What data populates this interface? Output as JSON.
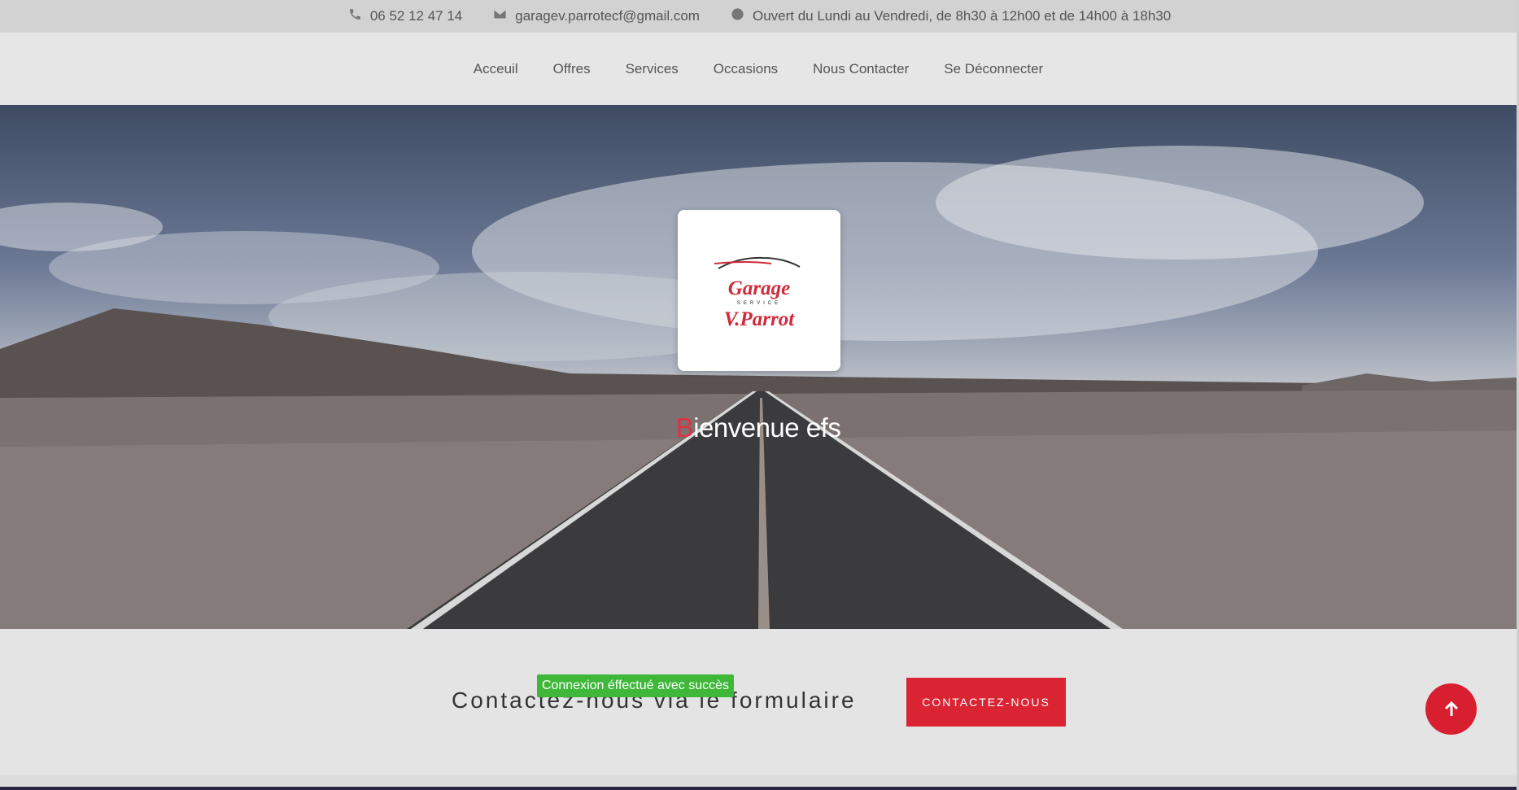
{
  "topbar": {
    "phone": "06 52 12 47 14",
    "email": "garagev.parrotecf@gmail.com",
    "hours": "Ouvert du Lundi au Vendredi, de 8h30 à 12h00 et de 14h00 à 18h30",
    "icons": [
      "phone-icon",
      "envelope-icon",
      "clock-icon"
    ]
  },
  "nav": {
    "items": [
      "Acceuil",
      "Offres",
      "Services",
      "Occasions",
      "Nous Contacter",
      "Se Déconnecter"
    ]
  },
  "hero": {
    "logo": {
      "line1": "Garage",
      "line2": "SERVICE",
      "line3": "V.Parrot"
    },
    "title_first_letter": "B",
    "title_rest": "ienvenue efs"
  },
  "contact": {
    "text": "Contactez-nous via le formulaire",
    "button_label": "CONTACTEZ-NOUS",
    "toast": "Connexion éffectué avec succès"
  },
  "colors": {
    "accent": "#da2433",
    "toast": "#3fb83a",
    "topbar": "#d2d2d2"
  }
}
